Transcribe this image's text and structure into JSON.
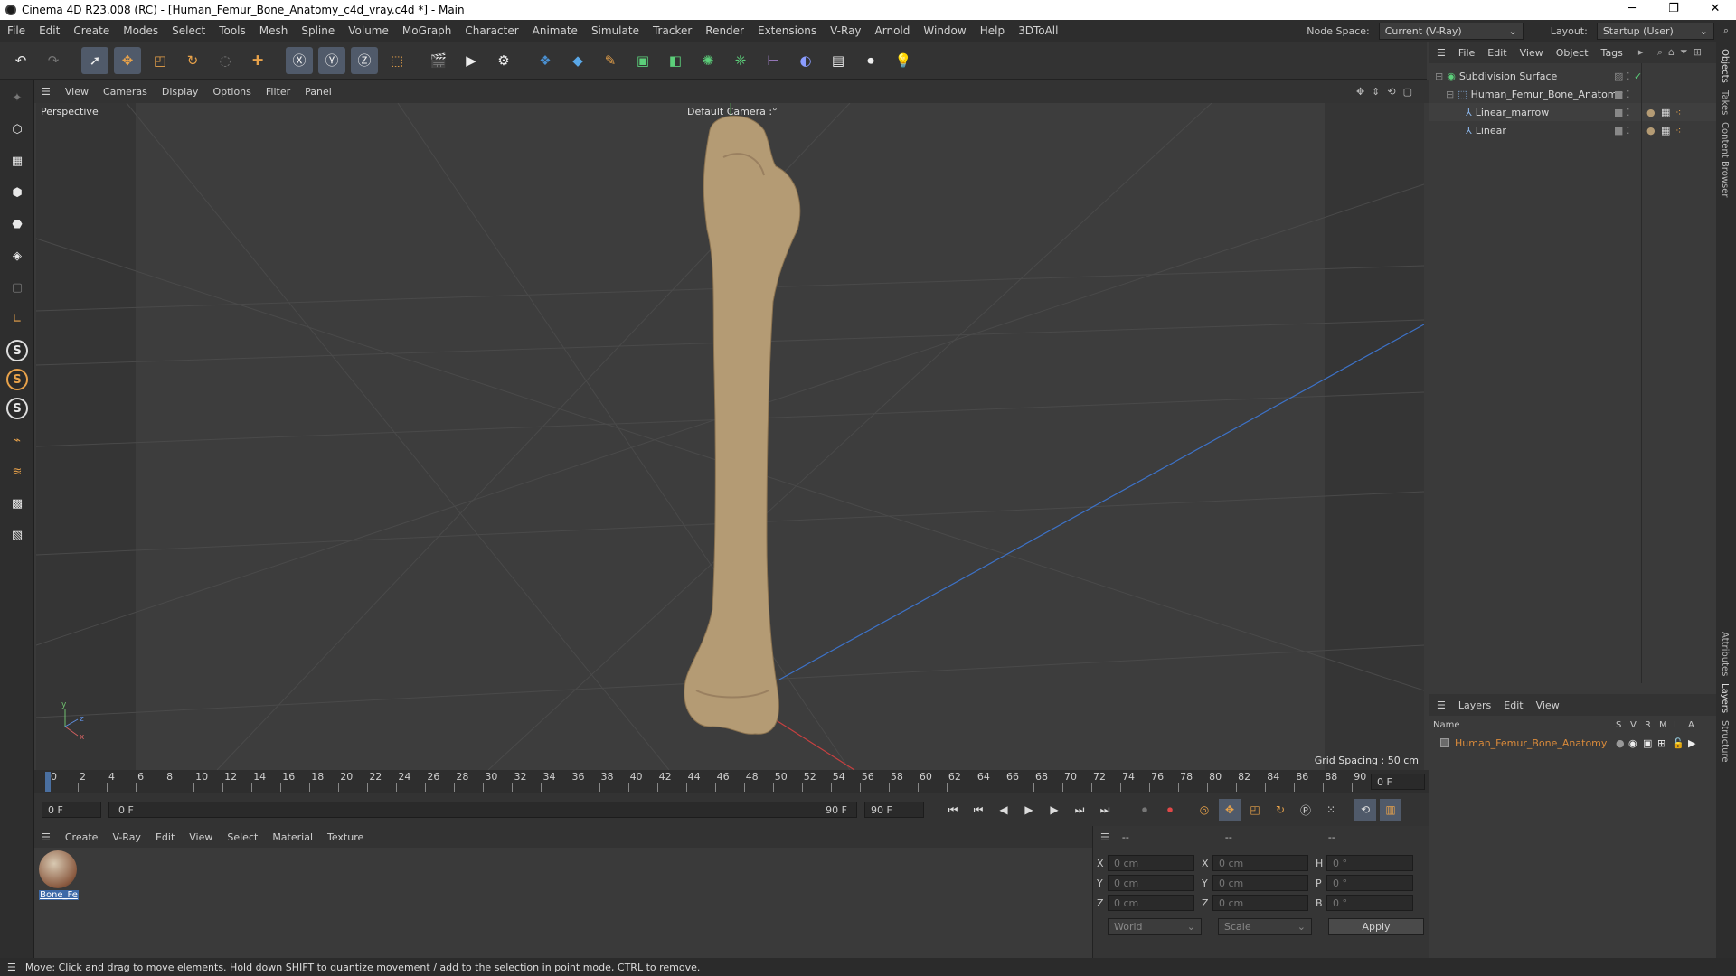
{
  "window": {
    "title": "Cinema 4D R23.008 (RC) - [Human_Femur_Bone_Anatomy_c4d_vray.c4d *] - Main",
    "minimize": "─",
    "maximize": "❐",
    "close": "✕"
  },
  "menubar": {
    "items": [
      "File",
      "Edit",
      "Create",
      "Modes",
      "Select",
      "Tools",
      "Mesh",
      "Spline",
      "Volume",
      "MoGraph",
      "Character",
      "Animate",
      "Simulate",
      "Tracker",
      "Render",
      "Extensions",
      "V-Ray",
      "Arnold",
      "Window",
      "Help",
      "3DToAll"
    ],
    "node_space_label": "Node Space:",
    "node_space_value": "Current (V-Ray)",
    "layout_label": "Layout:",
    "layout_value": "Startup (User)"
  },
  "viewport_menu": {
    "items": [
      "View",
      "Cameras",
      "Display",
      "Options",
      "Filter",
      "Panel"
    ]
  },
  "viewport": {
    "name": "Perspective",
    "camera": "Default Camera",
    "camera_suffix": ":°",
    "grid_spacing": "Grid Spacing : 50 cm"
  },
  "timeline": {
    "ticks": [
      "0",
      "2",
      "4",
      "6",
      "8",
      "10",
      "12",
      "14",
      "16",
      "18",
      "20",
      "22",
      "24",
      "26",
      "28",
      "30",
      "32",
      "34",
      "36",
      "38",
      "40",
      "42",
      "44",
      "46",
      "48",
      "50",
      "52",
      "54",
      "56",
      "58",
      "60",
      "62",
      "64",
      "66",
      "68",
      "70",
      "72",
      "74",
      "76",
      "78",
      "80",
      "82",
      "84",
      "86",
      "88",
      "90"
    ],
    "current_frame": "0 F"
  },
  "animation": {
    "start_field": "0 F",
    "current_field": "0 F",
    "end_field": "90 F",
    "max_field": "90 F"
  },
  "material_menu": {
    "items": [
      "Create",
      "V-Ray",
      "Edit",
      "View",
      "Select",
      "Material",
      "Texture"
    ]
  },
  "materials": [
    {
      "name": "Bone_Fe"
    }
  ],
  "coords": {
    "header": [
      "--",
      "--",
      "--"
    ],
    "rows": [
      {
        "a": "X",
        "av": "0 cm",
        "b": "X",
        "bv": "0 cm",
        "c": "H",
        "cv": "0 °"
      },
      {
        "a": "Y",
        "av": "0 cm",
        "b": "Y",
        "bv": "0 cm",
        "c": "P",
        "cv": "0 °"
      },
      {
        "a": "Z",
        "av": "0 cm",
        "b": "Z",
        "bv": "0 cm",
        "c": "B",
        "cv": "0 °"
      }
    ],
    "world": "World",
    "scale": "Scale",
    "apply": "Apply"
  },
  "objects": {
    "menu": [
      "File",
      "Edit",
      "View",
      "Object",
      "Tags"
    ],
    "tree": [
      {
        "name": "Subdivision Surface",
        "indent": 0
      },
      {
        "name": "Human_Femur_Bone_Anatomy",
        "indent": 1
      },
      {
        "name": "Linear_marrow",
        "indent": 2
      },
      {
        "name": "Linear",
        "indent": 2
      }
    ]
  },
  "layers": {
    "menu": [
      "Layers",
      "Edit",
      "View"
    ],
    "columns": [
      "Name",
      "S",
      "V",
      "R",
      "M",
      "L",
      "A"
    ],
    "rows": [
      {
        "name": "Human_Femur_Bone_Anatomy",
        "color": "#d98a3a"
      }
    ]
  },
  "side_tabs": [
    "Objects",
    "Takes",
    "Content Browser",
    "Attributes",
    "Layers",
    "Structure"
  ],
  "status": "Move: Click and drag to move elements. Hold down SHIFT to quantize movement / add to the selection in point mode, CTRL to remove.",
  "colors": {
    "accent": "#d98a3a",
    "selection": "#505a6a",
    "axis_x": "#c84040",
    "axis_z": "#3d72c8"
  }
}
